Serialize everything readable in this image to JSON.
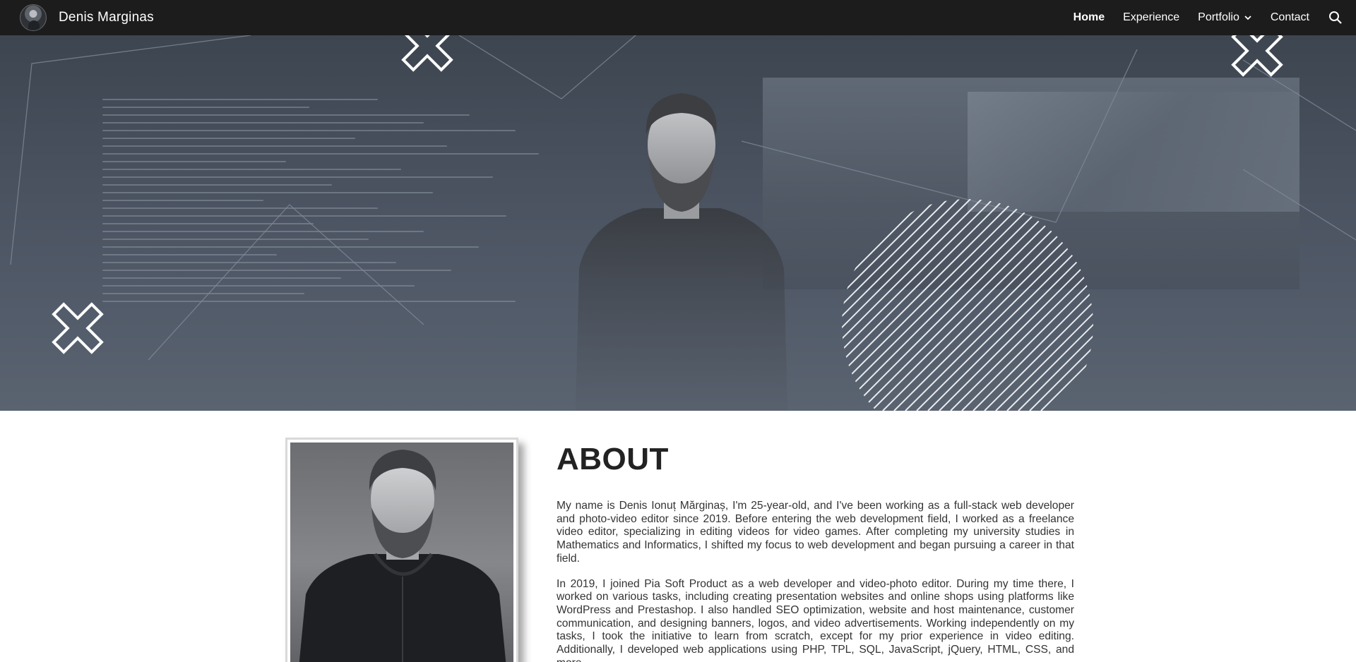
{
  "nav": {
    "brand_name": "Denis Marginas",
    "items": [
      {
        "label": "Home",
        "active": true
      },
      {
        "label": "Experience",
        "active": false
      },
      {
        "label": "Portfolio",
        "active": false,
        "has_dropdown": true
      },
      {
        "label": "Contact",
        "active": false
      }
    ],
    "search_icon": "search-icon",
    "dropdown_icon": "chevron-down-icon"
  },
  "hero": {
    "decorations": [
      "x-mark-icon",
      "x-mark-icon",
      "x-mark-icon",
      "striped-circle",
      "triangle-outline"
    ]
  },
  "about": {
    "title": "ABOUT",
    "paragraphs": [
      "My name is Denis Ionuț Mărginaș, I'm 25-year-old, and I've been working as a full-stack web developer and photo-video editor since 2019. Before entering the web development field, I worked as a freelance video editor, specializing in editing videos for video games. After completing my university studies in Mathematics and Informatics, I shifted my focus to web development and began pursuing a career in that field.",
      "In 2019, I joined Pia Soft Product as a web developer and video-photo editor. During my time there, I worked on various tasks, including creating presentation websites and online shops using platforms like WordPress and Prestashop. I also handled SEO optimization, website and host maintenance, customer communication, and designing banners, logos, and video advertisements. Working independently on my tasks, I took the initiative to learn from scratch, except for my prior experience in video editing. Additionally, I developed web applications using PHP, TPL, SQL, JavaScript, jQuery, HTML, CSS, and more."
    ]
  },
  "colors": {
    "navbar_bg": "#1c1c1c",
    "hero_bg": "#4a5260",
    "text": "#333333",
    "title": "#222222"
  }
}
